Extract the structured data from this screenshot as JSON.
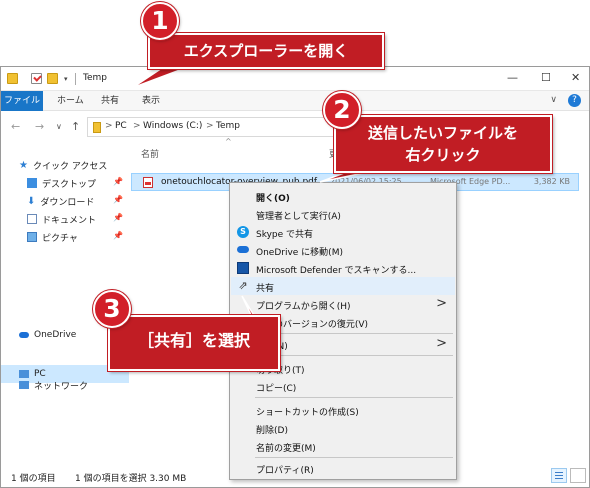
{
  "window": {
    "title": "Temp",
    "controls": {
      "minimize": "—",
      "maximize": "☐",
      "close": "✕"
    }
  },
  "ribbon": {
    "tabs": [
      "ファイル",
      "ホーム",
      "共有",
      "表示"
    ],
    "caret": "∨",
    "help": "?"
  },
  "nav": {
    "back": "←",
    "forward": "→",
    "dropdown": "∨",
    "up": "↑"
  },
  "address": {
    "sep": ">",
    "crumbs": [
      "PC",
      "Windows (C:)",
      "Temp"
    ]
  },
  "sidebar": {
    "quick_access": "クイック アクセス",
    "items": [
      "デスクトップ",
      "ダウンロード",
      "ドキュメント",
      "ピクチャ"
    ],
    "pin": "📌",
    "onedrive": "OneDrive",
    "pc": "PC",
    "network": "ネットワーク"
  },
  "content": {
    "col_name": "名前",
    "col_date": "更",
    "sort_caret": "^",
    "file": {
      "name": "onetouchlocator-overview_pub.pdf",
      "date": "2021/06/02 15:25",
      "type": "Microsoft Edge PD...",
      "size": "3,382 KB"
    }
  },
  "status": {
    "count": "1 個の項目",
    "selected": "1 個の項目を選択  3.30 MB"
  },
  "context_menu": {
    "open": "開く(O)",
    "run_as_admin": "管理者として実行(A)",
    "skype_share": "Skype で共有",
    "onedrive_move": "OneDrive に移動(M)",
    "defender_scan": "Microsoft Defender でスキャンする...",
    "share": "共有",
    "open_with": "プログラムから開く(H)",
    "restore_previous": "以前のバージョンの復元(V)",
    "send_to": "送る(N)",
    "cut": "切り取り(T)",
    "copy": "コピー(C)",
    "create_shortcut": "ショートカットの作成(S)",
    "delete": "削除(D)",
    "rename": "名前の変更(M)",
    "properties": "プロパティ(R)",
    "arrow": ">",
    "skype_letter": "S",
    "share_glyph": "⇗"
  },
  "annotations": [
    {
      "number": "1",
      "text": "エクスプローラーを開く"
    },
    {
      "number": "2",
      "line1": "送信したいファイルを",
      "line2": "右クリック"
    },
    {
      "number": "3",
      "text": "［共有］を選択"
    }
  ],
  "colors": {
    "callout_red": "#c11d24",
    "ribbon_file_blue": "#1976c8",
    "selection_blue": "#cce8ff",
    "menu_bg": "#f0f0f0"
  }
}
